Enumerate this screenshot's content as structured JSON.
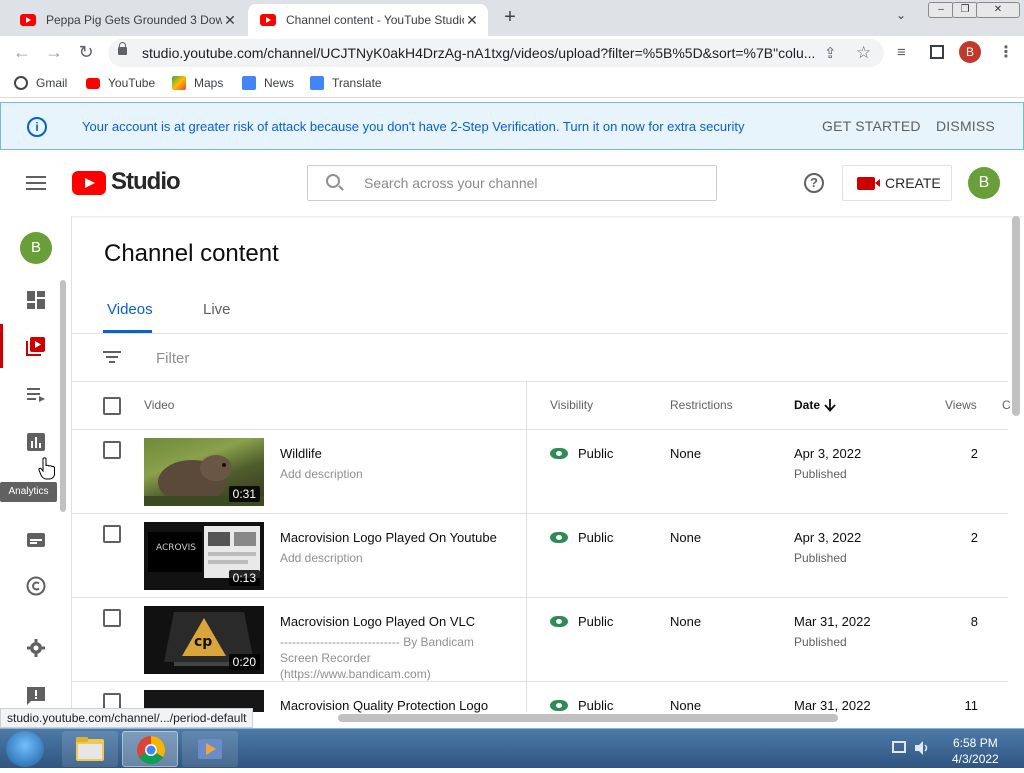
{
  "browser": {
    "tabs": [
      {
        "title": "Peppa Pig Gets Grounded 3 Dow"
      },
      {
        "title": "Channel content - YouTube Studio"
      }
    ],
    "url": "studio.youtube.com/channel/UCJTNyK0akH4DrzAg-nA1txg/videos/upload?filter=%5B%5D&sort=%7B\"colu...",
    "profile_initial": "B",
    "bookmarks": [
      "Gmail",
      "YouTube",
      "Maps",
      "News",
      "Translate"
    ],
    "status_url": "studio.youtube.com/channel/.../period-default"
  },
  "banner": {
    "message": "Your account is at greater risk of attack because you don't have 2-Step Verification. Turn it on now for extra security",
    "get_started": "GET STARTED",
    "dismiss": "DISMISS"
  },
  "header": {
    "logo_text": "Studio",
    "search_placeholder": "Search across your channel",
    "create_label": "CREATE",
    "avatar_initial": "B"
  },
  "sidebar": {
    "avatar_initial": "B",
    "tooltip": "Analytics"
  },
  "page": {
    "title": "Channel content",
    "tabs": [
      {
        "label": "Videos"
      },
      {
        "label": "Live"
      }
    ],
    "filter_label": "Filter",
    "columns": {
      "video": "Video",
      "visibility": "Visibility",
      "restrictions": "Restrictions",
      "date": "Date",
      "views": "Views",
      "comments": "C"
    },
    "rows": [
      {
        "title": "Wildlife",
        "description": "Add description",
        "duration": "0:31",
        "visibility": "Public",
        "restrictions": "None",
        "date": "Apr 3, 2022",
        "date_status": "Published",
        "views": "2"
      },
      {
        "title": "Macrovision Logo Played On Youtube",
        "description": "Add description",
        "duration": "0:13",
        "visibility": "Public",
        "restrictions": "None",
        "date": "Apr 3, 2022",
        "date_status": "Published",
        "views": "2"
      },
      {
        "title": "Macrovision Logo Played On VLC",
        "description": "------------------------------ By Bandicam Screen Recorder (https://www.bandicam.com)",
        "duration": "0:20",
        "visibility": "Public",
        "restrictions": "None",
        "date": "Mar 31, 2022",
        "date_status": "Published",
        "views": "8"
      },
      {
        "title": "Macrovision Quality Protection Logo",
        "description": "",
        "duration": "",
        "visibility": "Public",
        "restrictions": "None",
        "date": "Mar 31, 2022",
        "date_status": "",
        "views": "11"
      }
    ]
  },
  "taskbar": {
    "time": "6:58 PM",
    "date": "4/3/2022"
  }
}
